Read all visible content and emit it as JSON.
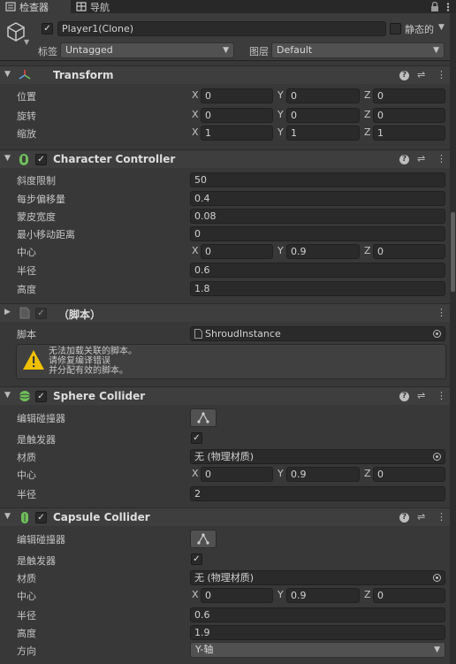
{
  "tabs": [
    {
      "label": "检查器",
      "icon": "inspector-icon",
      "active": true
    },
    {
      "label": "导航",
      "icon": "navigation-icon",
      "active": false
    }
  ],
  "object": {
    "name": "Player1(Clone)",
    "static_label": "静态的",
    "tag_label": "标签",
    "tag_value": "Untagged",
    "layer_label": "图层",
    "layer_value": "Default"
  },
  "transform": {
    "title": "Transform",
    "rows": [
      {
        "label": "位置",
        "x": "0",
        "y": "0",
        "z": "0"
      },
      {
        "label": "旋转",
        "x": "0",
        "y": "0",
        "z": "0"
      },
      {
        "label": "缩放",
        "x": "1",
        "y": "1",
        "z": "1"
      }
    ]
  },
  "axes": {
    "x": "X",
    "y": "Y",
    "z": "Z"
  },
  "character_controller": {
    "title": "Character Controller",
    "slope_label": "斜度限制",
    "slope": "50",
    "step_label": "每步偏移量",
    "step": "0.4",
    "skin_label": "蒙皮宽度",
    "skin": "0.08",
    "minmove_label": "最小移动距离",
    "minmove": "0",
    "center_label": "中心",
    "cx": "0",
    "cy": "0.9",
    "cz": "0",
    "radius_label": "半径",
    "radius": "0.6",
    "height_label": "高度",
    "height": "1.8"
  },
  "script": {
    "title": "（脚本）",
    "script_label": "脚本",
    "script_value": "ShroudInstance",
    "warning_lines": [
      "无法加载关联的脚本。",
      "请修复编译错误",
      "并分配有效的脚本。"
    ]
  },
  "sphere": {
    "title": "Sphere Collider",
    "edit_label": "编辑碰撞器",
    "trigger_label": "是触发器",
    "material_label": "材质",
    "material": "无 (物理材质)",
    "center_label": "中心",
    "cx": "0",
    "cy": "0.9",
    "cz": "0",
    "radius_label": "半径",
    "radius": "2"
  },
  "capsule": {
    "title": "Capsule Collider",
    "edit_label": "编辑碰撞器",
    "trigger_label": "是触发器",
    "material_label": "材质",
    "material": "无 (物理材质)",
    "center_label": "中心",
    "cx": "0",
    "cy": "0.9",
    "cz": "0",
    "radius_label": "半径",
    "radius": "0.6",
    "height_label": "高度",
    "height": "1.9",
    "direction_label": "方向",
    "direction": "Y-轴"
  },
  "colors": {
    "background": "#383838",
    "field": "#2a2a2a",
    "header": "#3e3e3e",
    "transform_icon": "#5fa3e6",
    "collider_icon": "#6fbf5a",
    "warning": "#f0c000"
  }
}
